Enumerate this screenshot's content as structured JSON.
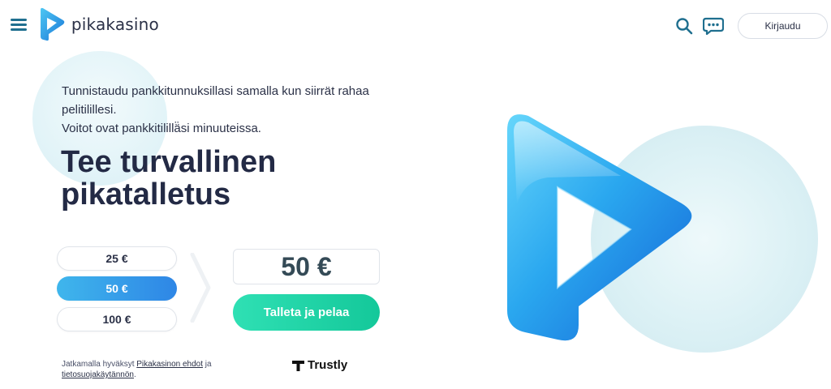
{
  "header": {
    "logo_text": "pikakasino",
    "login_label": "Kirjaudu"
  },
  "hero": {
    "subtitle_line1": "Tunnistaudu pankkitunnuksillasi samalla kun siirrät rahaa pelitilillesi.",
    "subtitle_line2": "Voitot ovat pankkitilillä̈si minuuteissa.",
    "headline": "Tee turvallinen pikatalletus"
  },
  "deposit": {
    "options": [
      "25 €",
      "50 €",
      "100 €"
    ],
    "selected_index": 1,
    "amount_display": "50 €",
    "button_label": "Talleta ja pelaa"
  },
  "terms": {
    "prefix": "Jatkamalla hyväksyt",
    "link1": "Pikakasinon ehdot",
    "middle": "ja",
    "link2": "tietosuojakäytännön",
    "suffix": "."
  },
  "payment_provider": "Trustly",
  "colors": {
    "accent_blue": "#2e86e6",
    "accent_green": "#14c89a",
    "text_dark": "#232a45"
  }
}
